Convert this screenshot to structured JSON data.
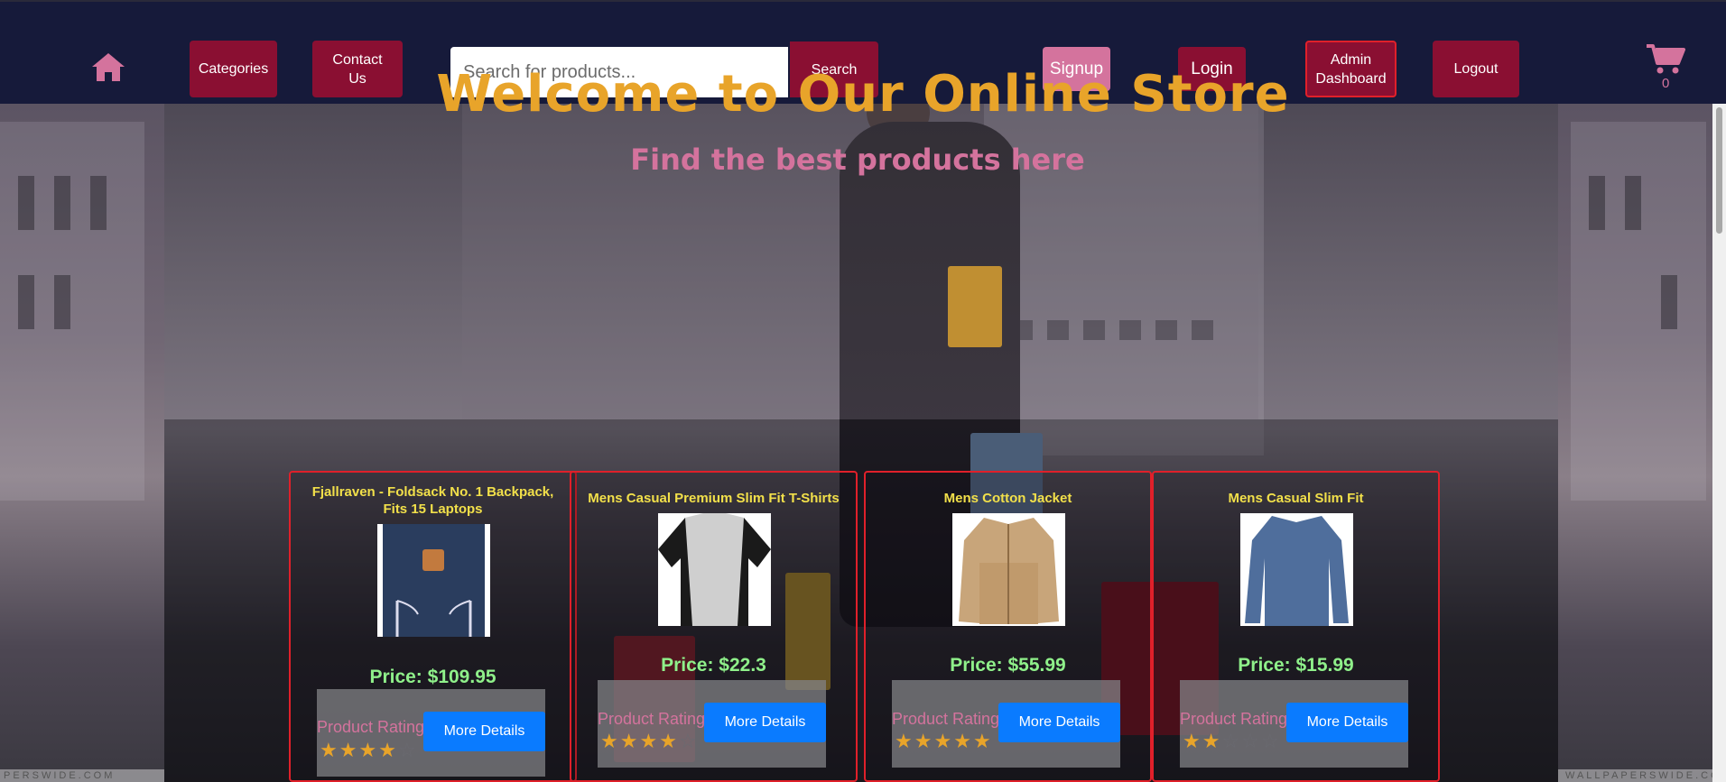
{
  "nav": {
    "home_icon": "home-icon",
    "categories_label": "Categories",
    "contact_label": "Contact Us",
    "search_placeholder": "Search for products...",
    "search_label": "Search",
    "signup_label": "Signup",
    "login_label": "Login",
    "admin_label": "Admin Dashboard",
    "logout_label": "Logout",
    "cart_icon": "cart-icon",
    "cart_count": "0"
  },
  "hero": {
    "title": "Welcome to Our Online Store",
    "subtitle": "Find the best products here"
  },
  "products": [
    {
      "title": "Fjallraven - Foldsack No. 1 Backpack, Fits 15 Laptops",
      "price": "Price: $109.95",
      "rating_label": "Product Rating",
      "rating": 4,
      "button_label": "More Details"
    },
    {
      "title": "Mens Casual Premium Slim Fit T-Shirts",
      "price": "Price: $22.3",
      "rating_label": "Product Rating",
      "rating": 4,
      "button_label": "More Details"
    },
    {
      "title": "Mens Cotton Jacket",
      "price": "Price: $55.99",
      "rating_label": "Product Rating",
      "rating": 5,
      "button_label": "More Details"
    },
    {
      "title": "Mens Casual Slim Fit",
      "price": "Price: $15.99",
      "rating_label": "Product Rating",
      "rating": 2,
      "button_label": "More Details"
    }
  ],
  "colors": {
    "nav_bg": "#161a3a",
    "button_bg": "#8a0f32",
    "accent_pink": "#d4739d",
    "title_gold": "#e8a42a",
    "price_green": "#8ff08a",
    "card_border": "#e0202a",
    "details_blue": "#0a7bff"
  }
}
